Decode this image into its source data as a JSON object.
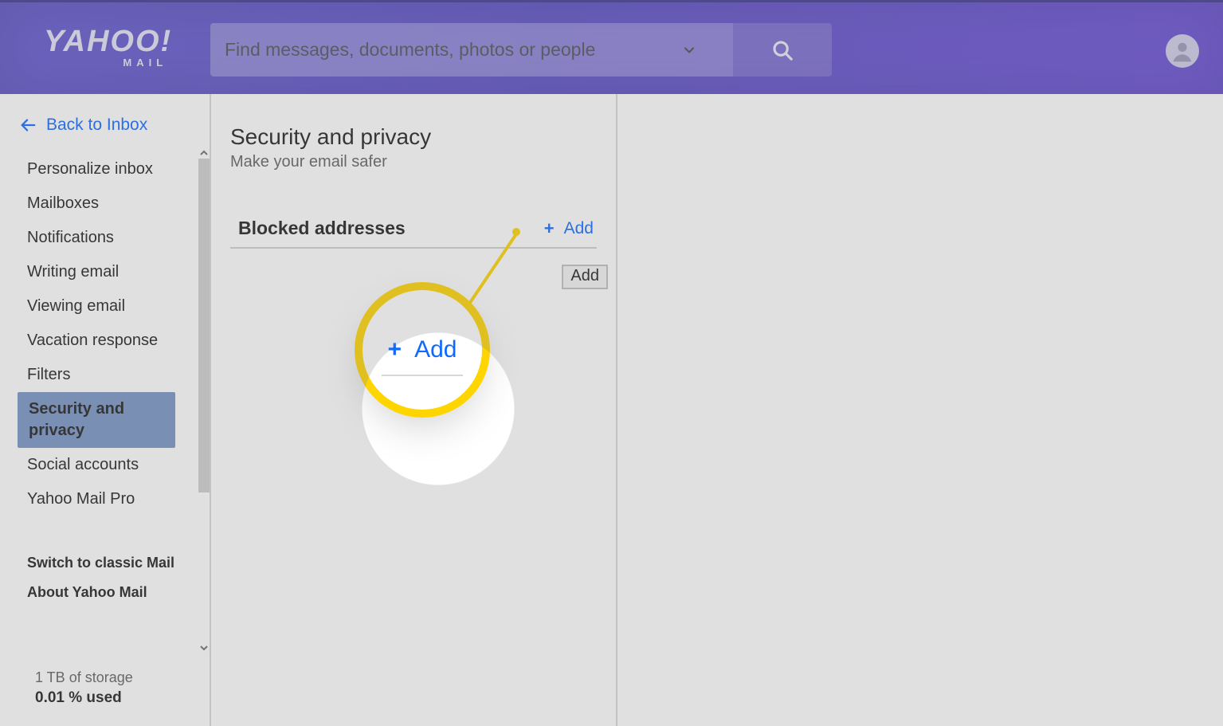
{
  "logo": {
    "main": "YAHOO!",
    "sub": "MAIL"
  },
  "search": {
    "placeholder": "Find messages, documents, photos or people"
  },
  "sidebar": {
    "back_label": "Back to Inbox",
    "items": [
      {
        "label": "Personalize inbox"
      },
      {
        "label": "Mailboxes"
      },
      {
        "label": "Notifications"
      },
      {
        "label": "Writing email"
      },
      {
        "label": "Viewing email"
      },
      {
        "label": "Vacation response"
      },
      {
        "label": "Filters"
      },
      {
        "label": "Security and privacy"
      },
      {
        "label": "Social accounts"
      },
      {
        "label": "Yahoo Mail Pro"
      }
    ],
    "active_index": 7,
    "extra": [
      {
        "label": "Switch to classic Mail"
      },
      {
        "label": "About Yahoo Mail"
      }
    ]
  },
  "storage": {
    "line1": "1 TB of storage",
    "line2": "0.01 % used"
  },
  "panel": {
    "title": "Security and privacy",
    "subtitle": "Make your email safer",
    "section_title": "Blocked addresses",
    "add_label": "Add",
    "tooltip": "Add"
  },
  "callout": {
    "label": "Add"
  }
}
